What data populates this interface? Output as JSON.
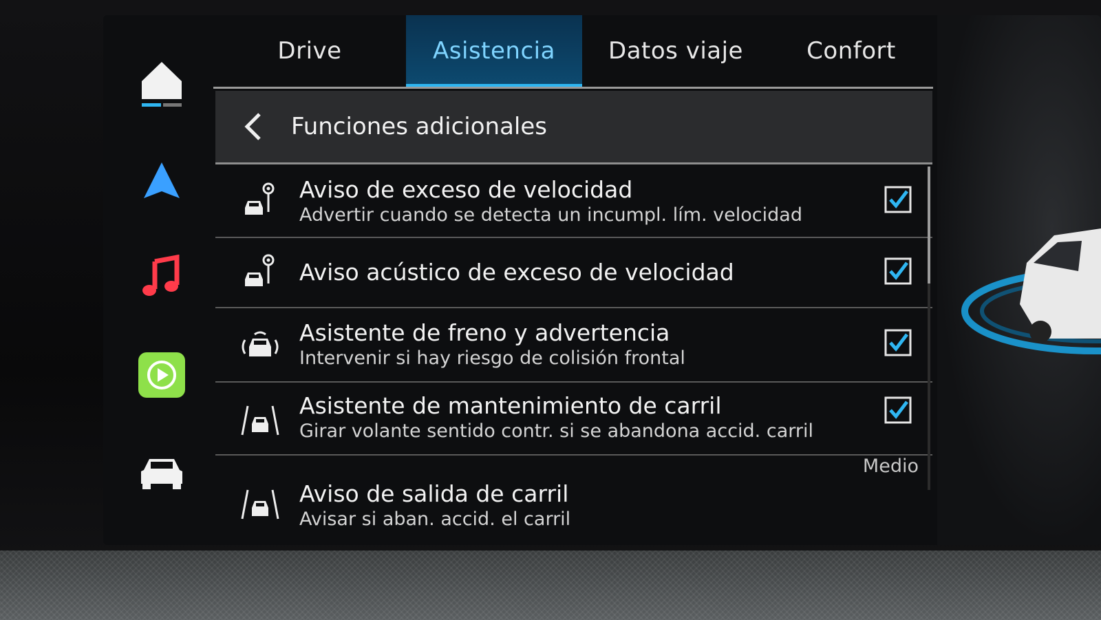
{
  "tabs": [
    {
      "label": "Drive",
      "active": false
    },
    {
      "label": "Asistencia",
      "active": true
    },
    {
      "label": "Datos viaje",
      "active": false
    },
    {
      "label": "Confort",
      "active": false
    }
  ],
  "header": {
    "title": "Funciones adicionales"
  },
  "rail": [
    {
      "icon": "home-icon"
    },
    {
      "icon": "navigation-icon"
    },
    {
      "icon": "music-icon"
    },
    {
      "icon": "carplay-icon"
    },
    {
      "icon": "car-icon"
    }
  ],
  "items": [
    {
      "title": "Aviso de exceso de velocidad",
      "subtitle": "Advertir cuando se detecta un incumpl. lím. velocidad",
      "checked": true,
      "icon": "speed-sign-car-icon"
    },
    {
      "title": "Aviso acústico de exceso de velocidad",
      "subtitle": "",
      "checked": true,
      "icon": "speed-sign-car-icon"
    },
    {
      "title": "Asistente de freno y advertencia",
      "subtitle": "Intervenir si hay riesgo de colisión frontal",
      "checked": true,
      "icon": "collision-warning-icon"
    },
    {
      "title": "Asistente de mantenimiento de carril",
      "subtitle": "Girar volante sentido contr. si se abandona accid. carril",
      "checked": true,
      "icon": "lane-keep-icon"
    },
    {
      "title": "Aviso de salida de carril",
      "subtitle": "Avisar si aban. accid. el carril",
      "value": "Medio",
      "icon": "lane-departure-icon"
    }
  ],
  "colors": {
    "accent": "#2fb6f2",
    "tab_active_bg": "#0d4a70",
    "checkbox": "#2fb6f2",
    "carplay": "#8ee04a",
    "music": "#ff3b4a",
    "nav": "#3aa0ff"
  }
}
